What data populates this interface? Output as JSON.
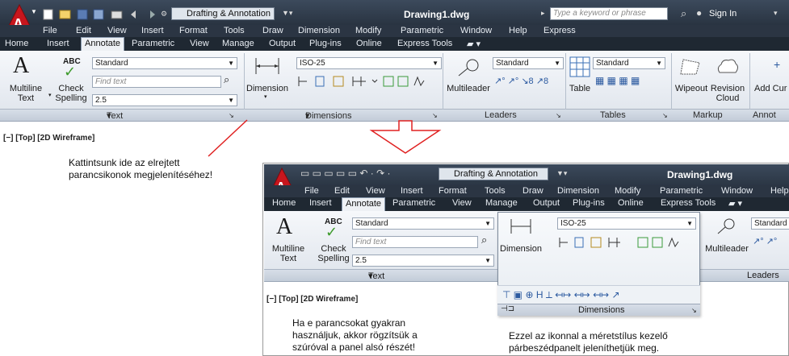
{
  "main_window": {
    "workspace": "Drafting & Annotation",
    "doc_title": "Drawing1.dwg",
    "search_placeholder": "Type a keyword or phrase",
    "sign_in": "Sign In",
    "menu": [
      "File",
      "Edit",
      "View",
      "Insert",
      "Format",
      "Tools",
      "Draw",
      "Dimension",
      "Modify",
      "Parametric",
      "Window",
      "Help",
      "Express"
    ],
    "tabs": [
      "Home",
      "Insert",
      "Annotate",
      "Parametric",
      "View",
      "Manage",
      "Output",
      "Plug-ins",
      "Online",
      "Express Tools"
    ],
    "active_tab": "Annotate",
    "text_panel": {
      "multiline_text": "Multiline Text",
      "abc": "ABC",
      "check_spelling": "Check Spelling",
      "style": "Standard",
      "find_text": "Find text",
      "height": "2.5",
      "panel_label": "Text"
    },
    "dimensions_panel": {
      "button": "Dimension",
      "style": "ISO-25",
      "panel_label": "Dimensions"
    },
    "leaders_panel": {
      "button": "Multileader",
      "style": "Standard",
      "panel_label": "Leaders"
    },
    "tables_panel": {
      "button": "Table",
      "style": "Standard",
      "panel_label": "Tables"
    },
    "markup_panel": {
      "wipeout": "Wipeout",
      "revision_cloud": "Revision Cloud",
      "panel_label": "Markup"
    },
    "annotation_panel": {
      "add_current": "Add Cur",
      "panel_label": "Annot"
    },
    "viewport_label": "[−] [Top] [2D Wireframe]"
  },
  "inset_window": {
    "workspace": "Drafting & Annotation",
    "doc_title": "Drawing1.dwg",
    "menu": [
      "File",
      "Edit",
      "View",
      "Insert",
      "Format",
      "Tools",
      "Draw",
      "Dimension",
      "Modify",
      "Parametric",
      "Window",
      "Help"
    ],
    "tabs": [
      "Home",
      "Insert",
      "Annotate",
      "Parametric",
      "View",
      "Manage",
      "Output",
      "Plug-ins",
      "Online",
      "Express Tools"
    ],
    "active_tab": "Annotate",
    "text_panel": {
      "multiline_text": "Multiline Text",
      "abc": "ABC",
      "check_spelling": "Check Spelling",
      "style": "Standard",
      "find_text": "Find text",
      "height": "2.5",
      "panel_label": "Text"
    },
    "dimensions_panel": {
      "button": "Dimension",
      "style": "ISO-25",
      "panel_label": "Dimensions"
    },
    "leaders_panel": {
      "button": "Multileader",
      "style": "Standard",
      "panel_label": "Leaders"
    },
    "viewport_label": "[−] [Top] [2D Wireframe]"
  },
  "annotations": {
    "click_here": [
      "Kattintsunk ide az elrejtett",
      "parancsikonok megjelenítéséhez!"
    ],
    "pin": [
      "Ha e parancsokat gyakran",
      "használjuk, akkor rögzítsük a",
      "szúróval a panel alsó részét!"
    ],
    "dialog": [
      "Ezzel az ikonnal a méretstílus kezelő",
      "párbeszédpanelt jeleníthetjük meg."
    ]
  },
  "colors": {
    "title_bg": "#2b3543",
    "ribbon_bg": "#eef1f5",
    "arrow_red": "#e02020",
    "acad_red": "#c8161d"
  }
}
